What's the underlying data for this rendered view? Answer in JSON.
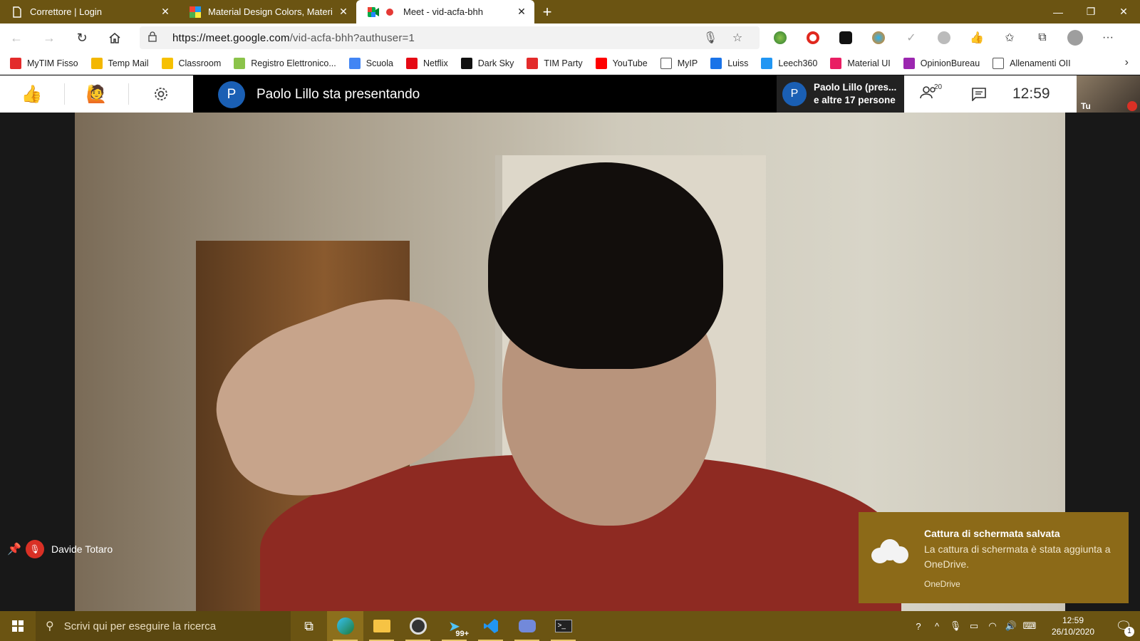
{
  "browser": {
    "tabs": [
      {
        "title": "Correttore | Login",
        "active": false
      },
      {
        "title": "Material Design Colors, Material",
        "active": false
      },
      {
        "title": "Meet - vid-acfa-bhh",
        "active": true
      }
    ],
    "url_host": "https://meet.google.com",
    "url_path": "/vid-acfa-bhh?authuser=1",
    "bookmarks": [
      {
        "label": "MyTIM Fisso",
        "icon": "tim-icon",
        "color": "#e32b2b"
      },
      {
        "label": "Temp Mail",
        "icon": "mail-icon",
        "color": "#f3b700"
      },
      {
        "label": "Classroom",
        "icon": "classroom-icon",
        "color": "#f6c000"
      },
      {
        "label": "Registro Elettronico...",
        "icon": "registro-icon",
        "color": "#8bc34a"
      },
      {
        "label": "Scuola",
        "icon": "google-icon",
        "color": "#4285f4"
      },
      {
        "label": "Netflix",
        "icon": "netflix-icon",
        "color": "#e50914"
      },
      {
        "label": "Dark Sky",
        "icon": "darksky-icon",
        "color": "#111111"
      },
      {
        "label": "TIM Party",
        "icon": "tim-icon",
        "color": "#e32b2b"
      },
      {
        "label": "YouTube",
        "icon": "youtube-icon",
        "color": "#ff0000"
      },
      {
        "label": "MyIP",
        "icon": "page-icon",
        "color": "#555555"
      },
      {
        "label": "Luiss",
        "icon": "luiss-icon",
        "color": "#1a73e8"
      },
      {
        "label": "Leech360",
        "icon": "cloud-icon",
        "color": "#2196f3"
      },
      {
        "label": "Material UI",
        "icon": "material-icon",
        "color": "#e91e63"
      },
      {
        "label": "OpinionBureau",
        "icon": "opinion-icon",
        "color": "#9c27b0"
      },
      {
        "label": "Allenamenti OII",
        "icon": "page-icon",
        "color": "#555555"
      }
    ]
  },
  "meet": {
    "presenter_initial": "P",
    "presenter_text": "Paolo Lillo sta presentando",
    "participants_chip_line1": "Paolo Lillo (pres...",
    "participants_chip_line2": "e altre 17 persone",
    "participant_count": "20",
    "clock": "12:59",
    "self_label": "Tu",
    "user_name": "Davide Totaro"
  },
  "toast": {
    "title": "Cattura di schermata salvata",
    "body": "La cattura di schermata è stata aggiunta a OneDrive.",
    "source": "OneDrive"
  },
  "taskbar": {
    "search_placeholder": "Scrivi qui per eseguire la ricerca",
    "telegram_badge": "99+",
    "time": "12:59",
    "date": "26/10/2020",
    "notifications": "1"
  },
  "colors": {
    "accent": "#6b5412",
    "meet_blue": "#1a5fb4",
    "mute_red": "#d93025"
  }
}
